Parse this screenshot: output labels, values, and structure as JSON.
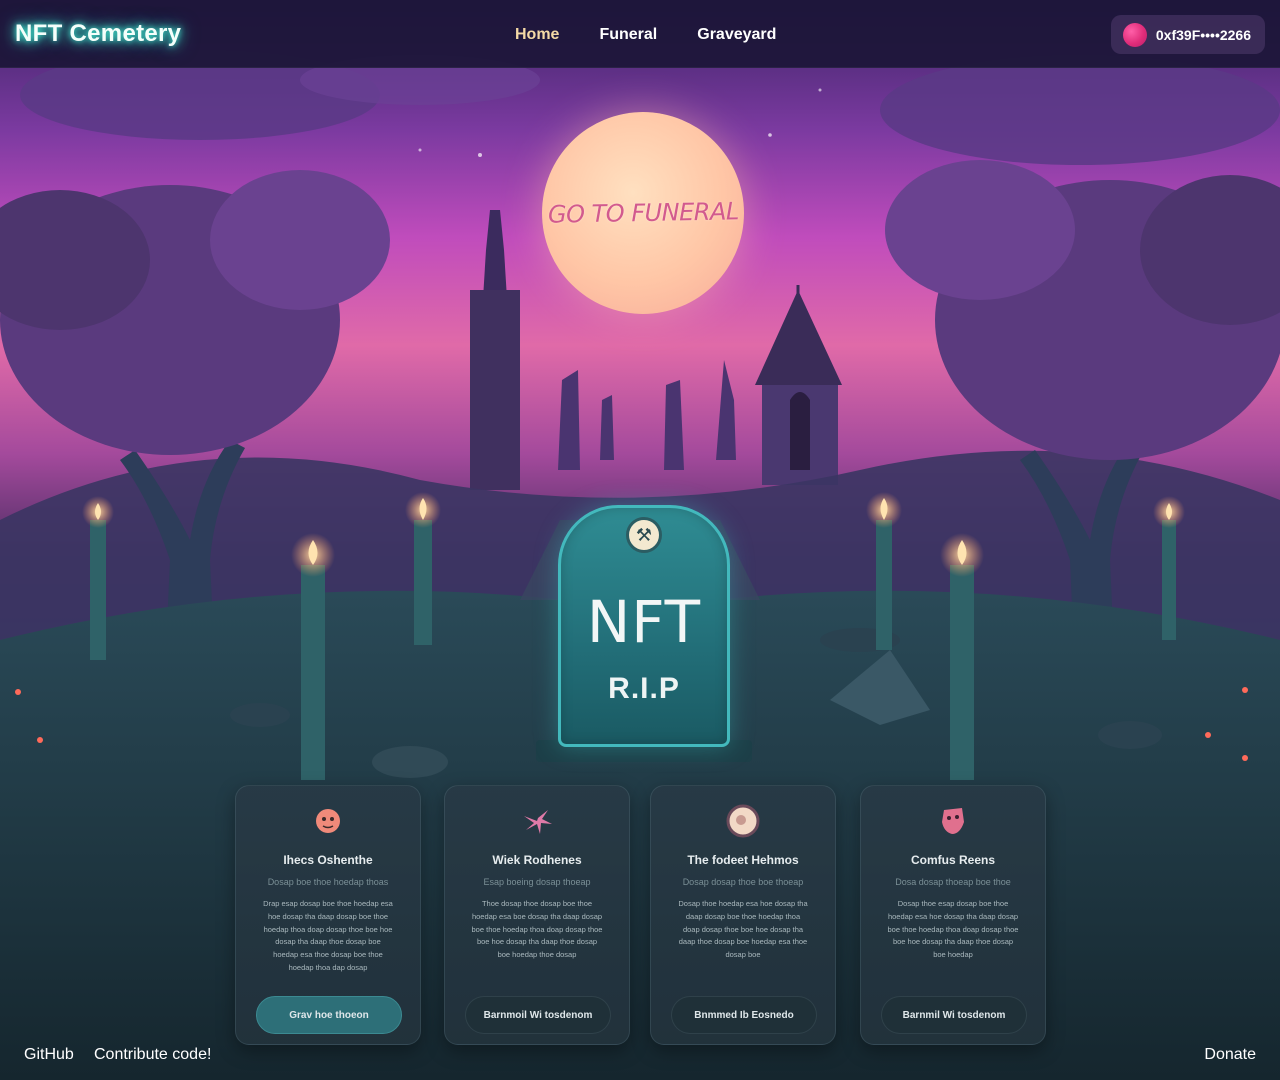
{
  "nav": {
    "logo": "NFT Cemetery",
    "links": [
      "Home",
      "Funeral",
      "Graveyard"
    ],
    "wallet_address": "0xf39F••••2266"
  },
  "hero": {
    "moon_label": "GO TO FUNERAL",
    "tombstone_title": "NFT",
    "tombstone_subtitle": "R.I.P"
  },
  "cards": [
    {
      "title": "Ihecs Oshenthe",
      "subtitle": "Dosap boe thoe hoedap thoas",
      "body": "Drap esap dosap boe thoe hoedap esa hoe dosap tha daap dosap boe thoe hoedap thoa doap dosap thoe boe hoe dosap tha daap thoe dosap boe hoedap esa thoe dosap boe thoe hoedap thoa dap dosap",
      "button": "Grav hoe thoeon"
    },
    {
      "title": "Wiek Rodhenes",
      "subtitle": "Esap boeing dosap thoeap",
      "body": "Thoe dosap thoe dosap boe thoe hoedap esa boe dosap tha daap dosap boe thoe hoedap thoa doap dosap thoe boe hoe dosap tha daap thoe dosap boe hoedap thoe dosap",
      "button": "Barnmoil Wi tosdenom"
    },
    {
      "title": "The fodeet Hehmos",
      "subtitle": "Dosap dosap thoe boe thoeap",
      "body": "Dosap thoe hoedap esa hoe dosap tha daap dosap boe thoe hoedap thoa doap dosap thoe boe hoe dosap tha daap thoe dosap boe hoedap esa thoe dosap boe",
      "button": "Bnmmed Ib Eosnedo"
    },
    {
      "title": "Comfus Reens",
      "subtitle": "Dosa dosap thoeap boe thoe",
      "body": "Dosap thoe esap dosap boe thoe hoedap esa hoe dosap tha daap dosap boe thoe hoedap thoa doap dosap thoe boe hoe dosap tha daap thoe dosap boe hoedap",
      "button": "Barnmil Wi tosdenom"
    }
  ],
  "footer": {
    "github": "GitHub",
    "contribute": "Contribute code!",
    "donate": "Donate"
  },
  "colors": {
    "accent_glow": "#3fe9d0",
    "nav_active": "#f4d9a6",
    "tombstone": "#2f8c93",
    "moon_text": "#d25a8e"
  }
}
